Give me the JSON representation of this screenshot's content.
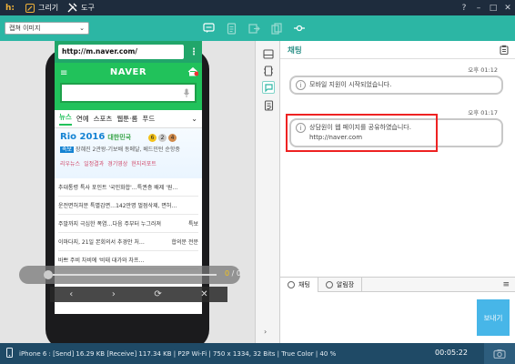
{
  "titlebar": {
    "logo": "h:",
    "menu": [
      {
        "label": "그리기",
        "icon": "pencil-icon"
      },
      {
        "label": "도구",
        "icon": "tools-icon"
      }
    ],
    "window_controls": [
      "?",
      "–",
      "□",
      "✕"
    ]
  },
  "toolbar": {
    "capture_select": {
      "value": "캡쳐 이미지",
      "arrow": "⌄"
    },
    "icons": [
      "chat-bubble-icon",
      "document-icon",
      "export-icon",
      "copy-icon",
      "link-icon"
    ]
  },
  "phone": {
    "url": "http://m.naver.com/",
    "menu_dots": "⋮",
    "naver_logo": "NAVER",
    "hamburger": "≡",
    "mic": "🎤",
    "tabs": [
      "뉴스",
      "연예",
      "스포츠",
      "웹툰·롬",
      "푸드"
    ],
    "tab_more": "⌄",
    "rio": {
      "title": "Rio 2016",
      "subtitle": "대한민국",
      "medals": [
        "6",
        "2",
        "4"
      ],
      "badge": "속보",
      "headline": "장혜진 2관왕-기보배 동메달, 베드민턴 순항중",
      "links": [
        "리우뉴스",
        "일정결과",
        "경기영상",
        "현지리포트"
      ]
    },
    "news": [
      {
        "title": "추대통령 특사 포인트 '국민화합'…특권층 배제 '원…",
        "tag": ""
      },
      {
        "title": "운전면허처분 특별감면…142만명 벌점삭제, 면허…",
        "tag": ""
      },
      {
        "title": "주말까지 극심한 폭염…다음 주부터 누그러져",
        "tag": "특보"
      },
      {
        "title": "이마다지, 21일 본회의서 추경안 처…",
        "tag": "합의문 전문"
      },
      {
        "title": "바쁘 주비 차비에 '비태 대가와 차프…",
        "tag": ""
      }
    ],
    "player": {
      "current": "0",
      "separator": "/",
      "total": "0"
    },
    "controls": [
      "‹",
      "›",
      "⟳",
      "✕"
    ]
  },
  "sidestrip": {
    "icons": [
      "drive-icon",
      "device-icon",
      "chat-panel-icon",
      "memo-icon"
    ],
    "collapse": "›"
  },
  "chat": {
    "title": "채팅",
    "messages": [
      {
        "time": "오후 01:12",
        "text": "모바일 지원이 시작되었습니다.",
        "url": ""
      },
      {
        "time": "오후 01:17",
        "text": "상담원이 웹 페이지를 공유하였습니다.",
        "url": "http://naver.com"
      }
    ],
    "tabs": [
      "채팅",
      "알림장"
    ],
    "menu": "≡",
    "send_label": "보내기"
  },
  "statusbar": {
    "info": "iPhone 6 : [Send] 16.29 KB  [Receive] 117.34 KB | P2P Wi-Fi | 750 x 1334, 32 Bits | True Color | 40 %",
    "timer": "00:05:22"
  },
  "colors": {
    "titlebar": "#1e2c3d",
    "toolbar": "#2cb6a4",
    "naver_green": "#21c25b",
    "send_button": "#47b6e8",
    "statusbar": "#1f4a66",
    "highlight": "#e22222"
  }
}
